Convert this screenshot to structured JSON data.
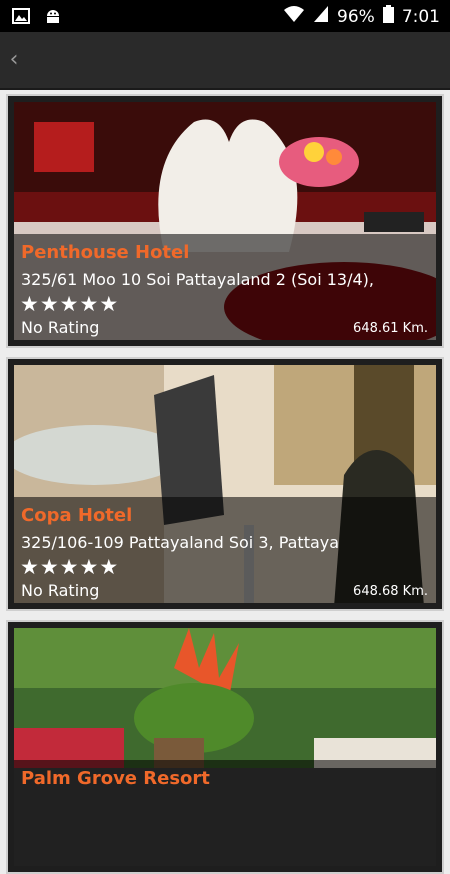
{
  "status_bar": {
    "battery": "96%",
    "time": "7:01",
    "icons": [
      "image-icon",
      "android-icon",
      "wifi-icon",
      "signal-icon",
      "battery-icon"
    ]
  },
  "app_bar": {
    "back_icon": "chevron-left-icon"
  },
  "hotels": [
    {
      "name": "Penthouse Hotel",
      "address": "325/61 Moo 10 Soi Pattayaland 2 (Soi 13/4),",
      "stars": 5,
      "rating": "No Rating",
      "distance": "648.61 Km."
    },
    {
      "name": "Copa Hotel",
      "address": "325/106-109 Pattayaland Soi 3, Pattaya",
      "stars": 5,
      "rating": "No Rating",
      "distance": "648.68 Km."
    },
    {
      "name": "Palm Grove Resort"
    }
  ],
  "colors": {
    "accent": "#f0692a",
    "statusbar": "#000000",
    "appbar": "#2a2a2a"
  }
}
